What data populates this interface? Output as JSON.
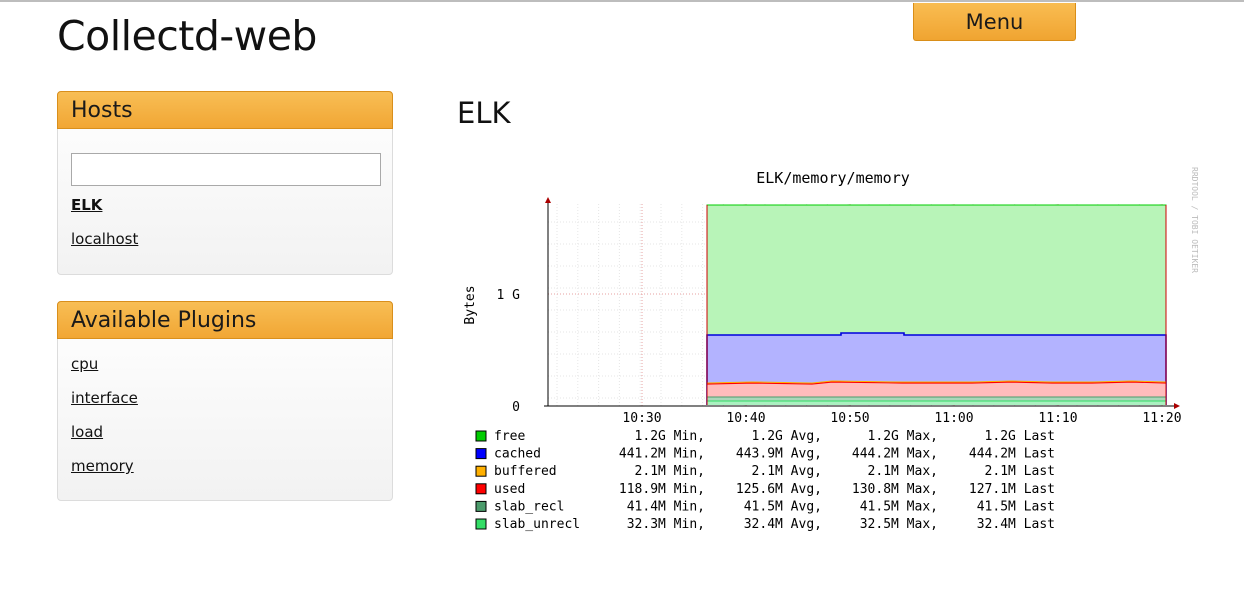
{
  "app": {
    "title": "Collectd-web"
  },
  "menu": {
    "label": "Menu"
  },
  "hosts_panel": {
    "title": "Hosts",
    "search": {
      "value": "",
      "placeholder": ""
    },
    "items": [
      {
        "label": "ELK",
        "selected": true
      },
      {
        "label": "localhost",
        "selected": false
      }
    ]
  },
  "plugins_panel": {
    "title": "Available Plugins",
    "items": [
      {
        "label": "cpu"
      },
      {
        "label": "interface"
      },
      {
        "label": "load"
      },
      {
        "label": "memory"
      }
    ]
  },
  "main": {
    "host_title": "ELK"
  },
  "graph": {
    "title": "ELK/memory/memory",
    "ylabel": "Bytes",
    "watermark": "RRDTOOL / TOBI OETIKER",
    "yticks": [
      "0",
      "1 G"
    ],
    "xticks": [
      "10:30",
      "10:40",
      "10:50",
      "11:00",
      "11:10",
      "11:20"
    ],
    "legend": [
      {
        "name": "free",
        "color": "#00cc00",
        "min": "1.2G Min,",
        "avg": "1.2G Avg,",
        "max": "1.2G Max,",
        "last": "1.2G Last"
      },
      {
        "name": "cached",
        "color": "#0000ff",
        "min": "441.2M Min,",
        "avg": "443.9M Avg,",
        "max": "444.2M Max,",
        "last": "444.2M Last"
      },
      {
        "name": "buffered",
        "color": "#ffb000",
        "min": "2.1M Min,",
        "avg": "2.1M Avg,",
        "max": "2.1M Max,",
        "last": "2.1M Last"
      },
      {
        "name": "used",
        "color": "#ff0000",
        "min": "118.9M Min,",
        "avg": "125.6M Avg,",
        "max": "130.8M Max,",
        "last": "127.1M Last"
      },
      {
        "name": "slab_recl",
        "color": "#4b9b6b",
        "min": "41.4M Min,",
        "avg": "41.5M Avg,",
        "max": "41.5M Max,",
        "last": "41.5M Last"
      },
      {
        "name": "slab_unrecl",
        "color": "#33dd66",
        "min": "32.3M Min,",
        "avg": "32.4M Avg,",
        "max": "32.5M Max,",
        "last": "32.4M Last"
      }
    ],
    "chart_data": {
      "type": "area",
      "x_start": "10:36",
      "x_end": "11:20",
      "stacked": true,
      "series": [
        {
          "name": "slab_unrecl",
          "approx_value_m": 32.4
        },
        {
          "name": "slab_recl",
          "approx_value_m": 41.5
        },
        {
          "name": "used",
          "approx_value_m": 126
        },
        {
          "name": "buffered",
          "approx_value_m": 2.1
        },
        {
          "name": "cached",
          "approx_value_m": 444
        },
        {
          "name": "free",
          "approx_value_m": 1200
        }
      ]
    }
  }
}
